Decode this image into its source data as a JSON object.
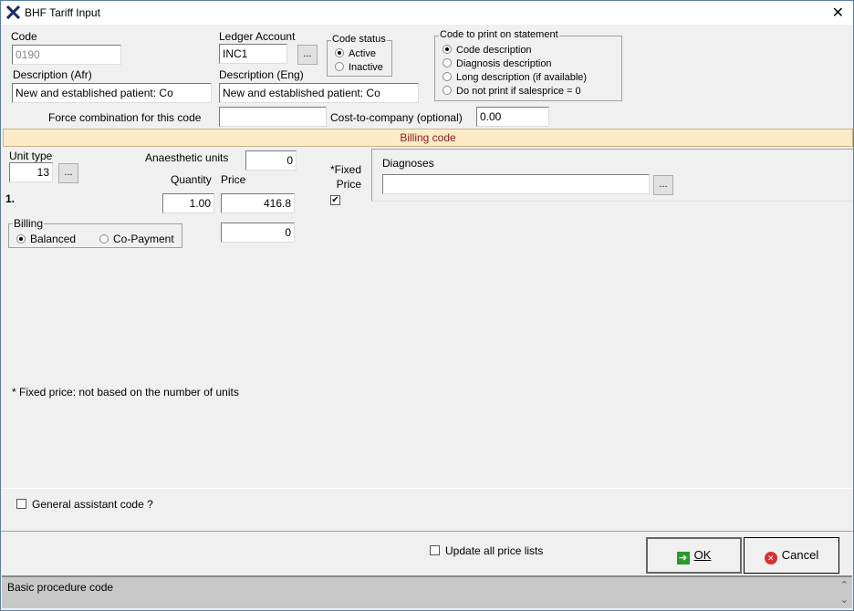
{
  "window": {
    "title": "BHF Tariff Input",
    "close": "✕"
  },
  "code": {
    "label": "Code",
    "value": "0190"
  },
  "ledger": {
    "label": "Ledger Account",
    "value": "INC1",
    "browse": "..."
  },
  "code_status": {
    "caption": "Code status",
    "options": [
      "Active",
      "Inactive"
    ],
    "selected": 0
  },
  "print_option": {
    "caption": "Code to print on statement",
    "options": [
      "Code description",
      "Diagnosis description",
      "Long description (if available)",
      "Do not print if salesprice = 0"
    ],
    "selected": 0
  },
  "desc_afr": {
    "label": "Description (Afr)",
    "value": "New and established patient: Co"
  },
  "desc_eng": {
    "label": "Description (Eng)",
    "value": "New and established patient: Co"
  },
  "force": {
    "label": "Force combination for this code",
    "value": ""
  },
  "cost": {
    "label": "Cost-to-company (optional)",
    "value": "0.00"
  },
  "billing_code_header": "Billing code",
  "unit_type": {
    "label": "Unit type",
    "value": "13",
    "browse": "..."
  },
  "anaesthetic": {
    "label": "Anaesthetic units",
    "value": "0"
  },
  "quantity": {
    "label": "Quantity",
    "value": "1.00"
  },
  "price": {
    "label": "Price",
    "value": "416.8",
    "extra": "0"
  },
  "row_number": "1.",
  "fixed_price": {
    "label1": "*Fixed",
    "label2": "Price",
    "checked": true
  },
  "diagnoses": {
    "label": "Diagnoses",
    "value": "",
    "browse": "..."
  },
  "billing": {
    "caption": "Billing",
    "options": [
      "Balanced",
      "Co-Payment"
    ],
    "selected": 0
  },
  "footnote": "* Fixed price: not based on the number of units",
  "general_assistant": {
    "label": "General assistant code ?",
    "checked": false
  },
  "update_prices": {
    "label": "Update all price lists",
    "checked": false
  },
  "ok_label": "OK",
  "cancel_label": "Cancel",
  "status_text": "Basic procedure code"
}
